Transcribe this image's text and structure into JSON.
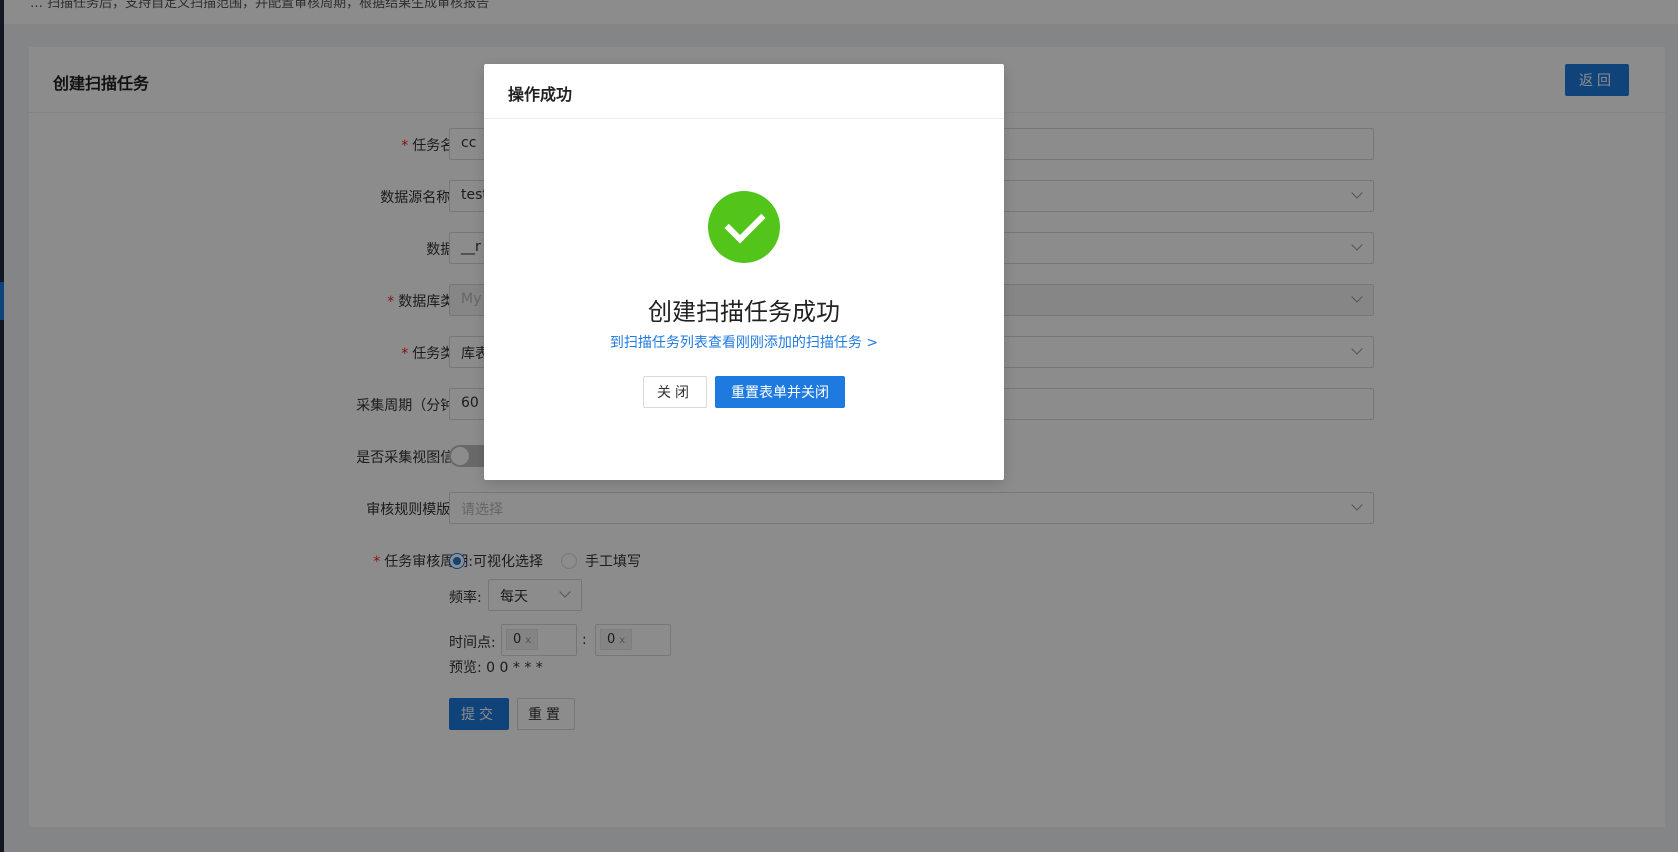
{
  "topbar_text": "… 扫描任务后，支持自定义扫描范围，并配置审核周期，根据结果生成审核报告",
  "card": {
    "title": "创建扫描任务",
    "back_label": "返回"
  },
  "form": {
    "task_name": {
      "label": "任务名称:",
      "value": "cc"
    },
    "datasource": {
      "label": "数据源名称",
      "suffix": ":",
      "value": "test"
    },
    "database": {
      "label": "数据库:",
      "value": "__r"
    },
    "db_type": {
      "label": "数据库类型:",
      "value": "My"
    },
    "task_type": {
      "label": "任务类型:",
      "value": "库表"
    },
    "period": {
      "label": "采集周期（分钟）:",
      "value": "60"
    },
    "view_info": {
      "label": "是否采集视图信息:"
    },
    "rule_template": {
      "label": "审核规则模版",
      "suffix": ":",
      "placeholder": "请选择"
    },
    "audit_cycle": {
      "label": "任务审核周期:",
      "option_visual": "可视化选择",
      "option_manual": "手工填写",
      "freq_label": "频率:",
      "freq_value": "每天",
      "time_label": "时间点:",
      "hour": "0",
      "colon": ":",
      "minute": "0",
      "preview": "预览: 0 0 * * *"
    },
    "submit_label": "提交",
    "reset_label": "重置"
  },
  "modal": {
    "header": "操作成功",
    "title": "创建扫描任务成功",
    "link": "到扫描任务列表查看刚刚添加的扫描任务 >",
    "close_label": "关闭",
    "reset_close_label": "重置表单并关闭"
  },
  "colors": {
    "primary": "#1f7ae0",
    "success": "#52c41a",
    "required": "#f5222d"
  }
}
